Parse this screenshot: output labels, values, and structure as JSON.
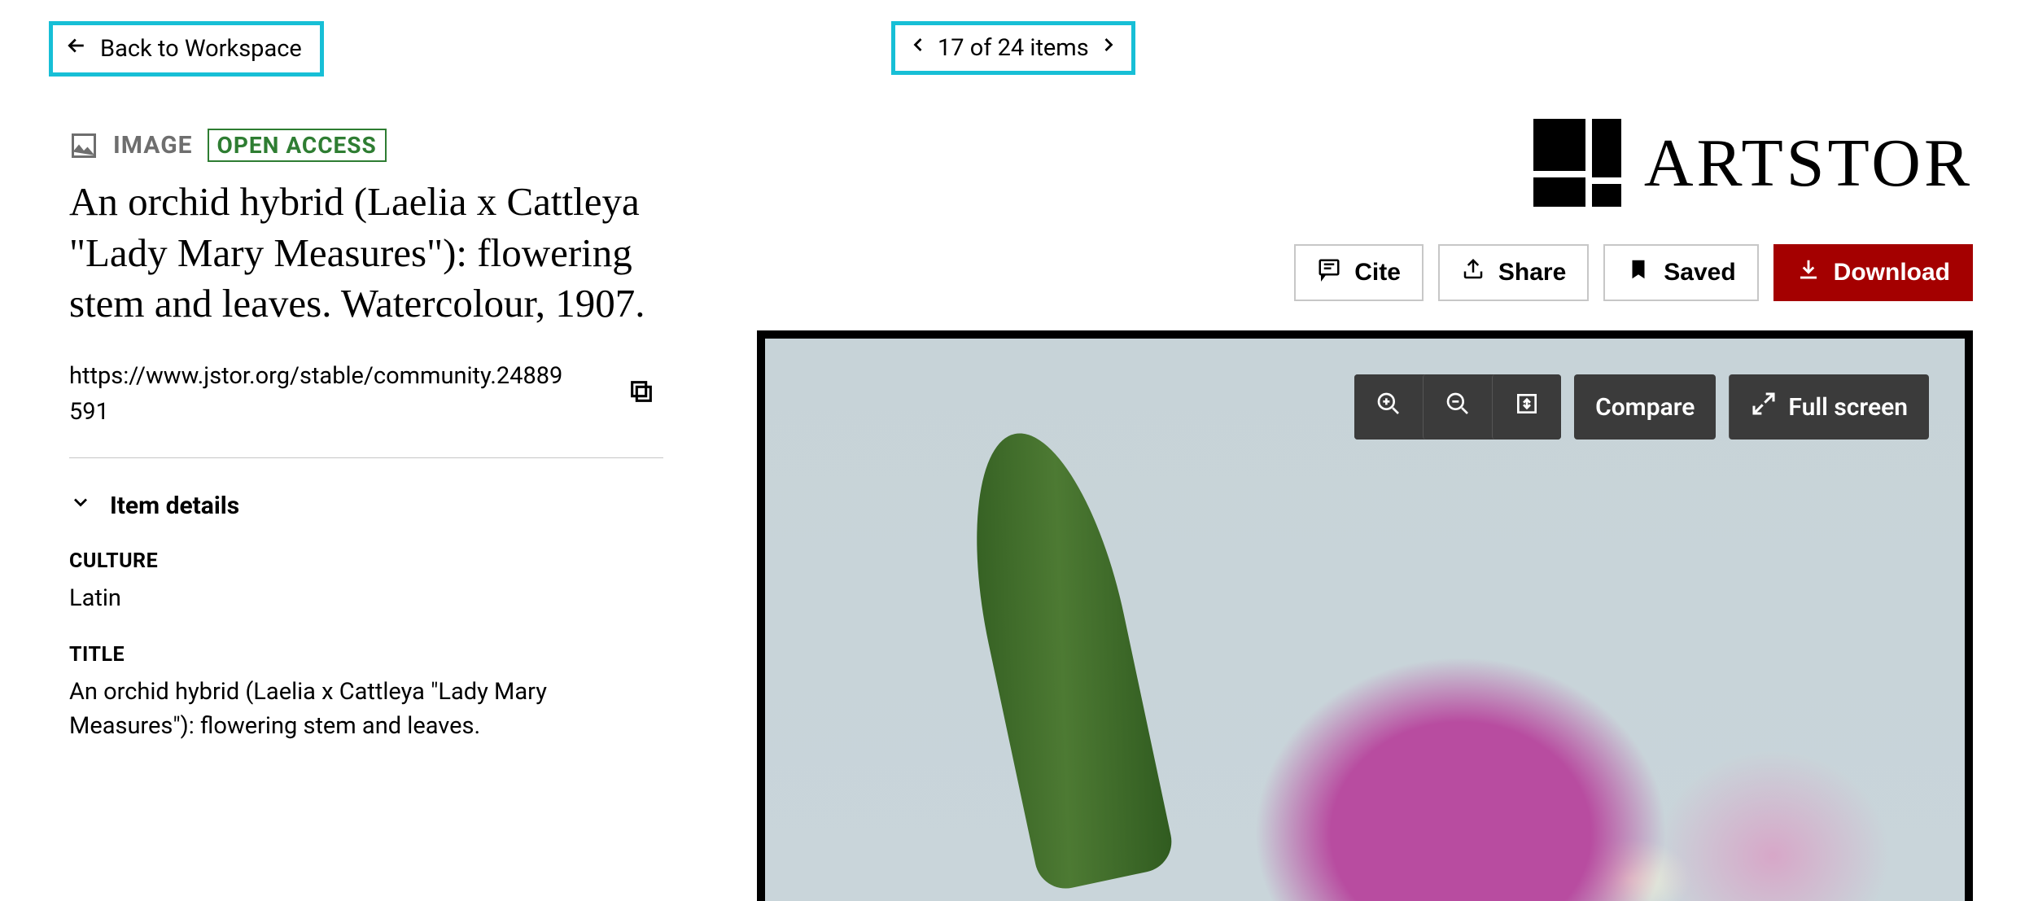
{
  "nav": {
    "back_label": "Back to Workspace",
    "pager_text": "17 of 24 items"
  },
  "brand": {
    "name": "ARTSTOR"
  },
  "item": {
    "type_label": "IMAGE",
    "access_badge": "OPEN ACCESS",
    "title": "An orchid hybrid (Laelia x Cattleya \"Lady Mary Measures\"): flowering stem and leaves. Watercolour, 1907.",
    "url": "https://www.jstor.org/stable/community.24889591",
    "details_heading": "Item details",
    "meta": {
      "culture_label": "CULTURE",
      "culture_value": "Latin",
      "title_label": "TITLE",
      "title_value": "An orchid hybrid (Laelia x Cattleya \"Lady Mary Measures\"): flowering stem and leaves."
    }
  },
  "actions": {
    "cite": "Cite",
    "share": "Share",
    "saved": "Saved",
    "download": "Download"
  },
  "viewer": {
    "compare": "Compare",
    "fullscreen": "Full screen"
  },
  "colors": {
    "highlight": "#17bfd6",
    "primary": "#a40000",
    "access": "#2e7d32"
  }
}
